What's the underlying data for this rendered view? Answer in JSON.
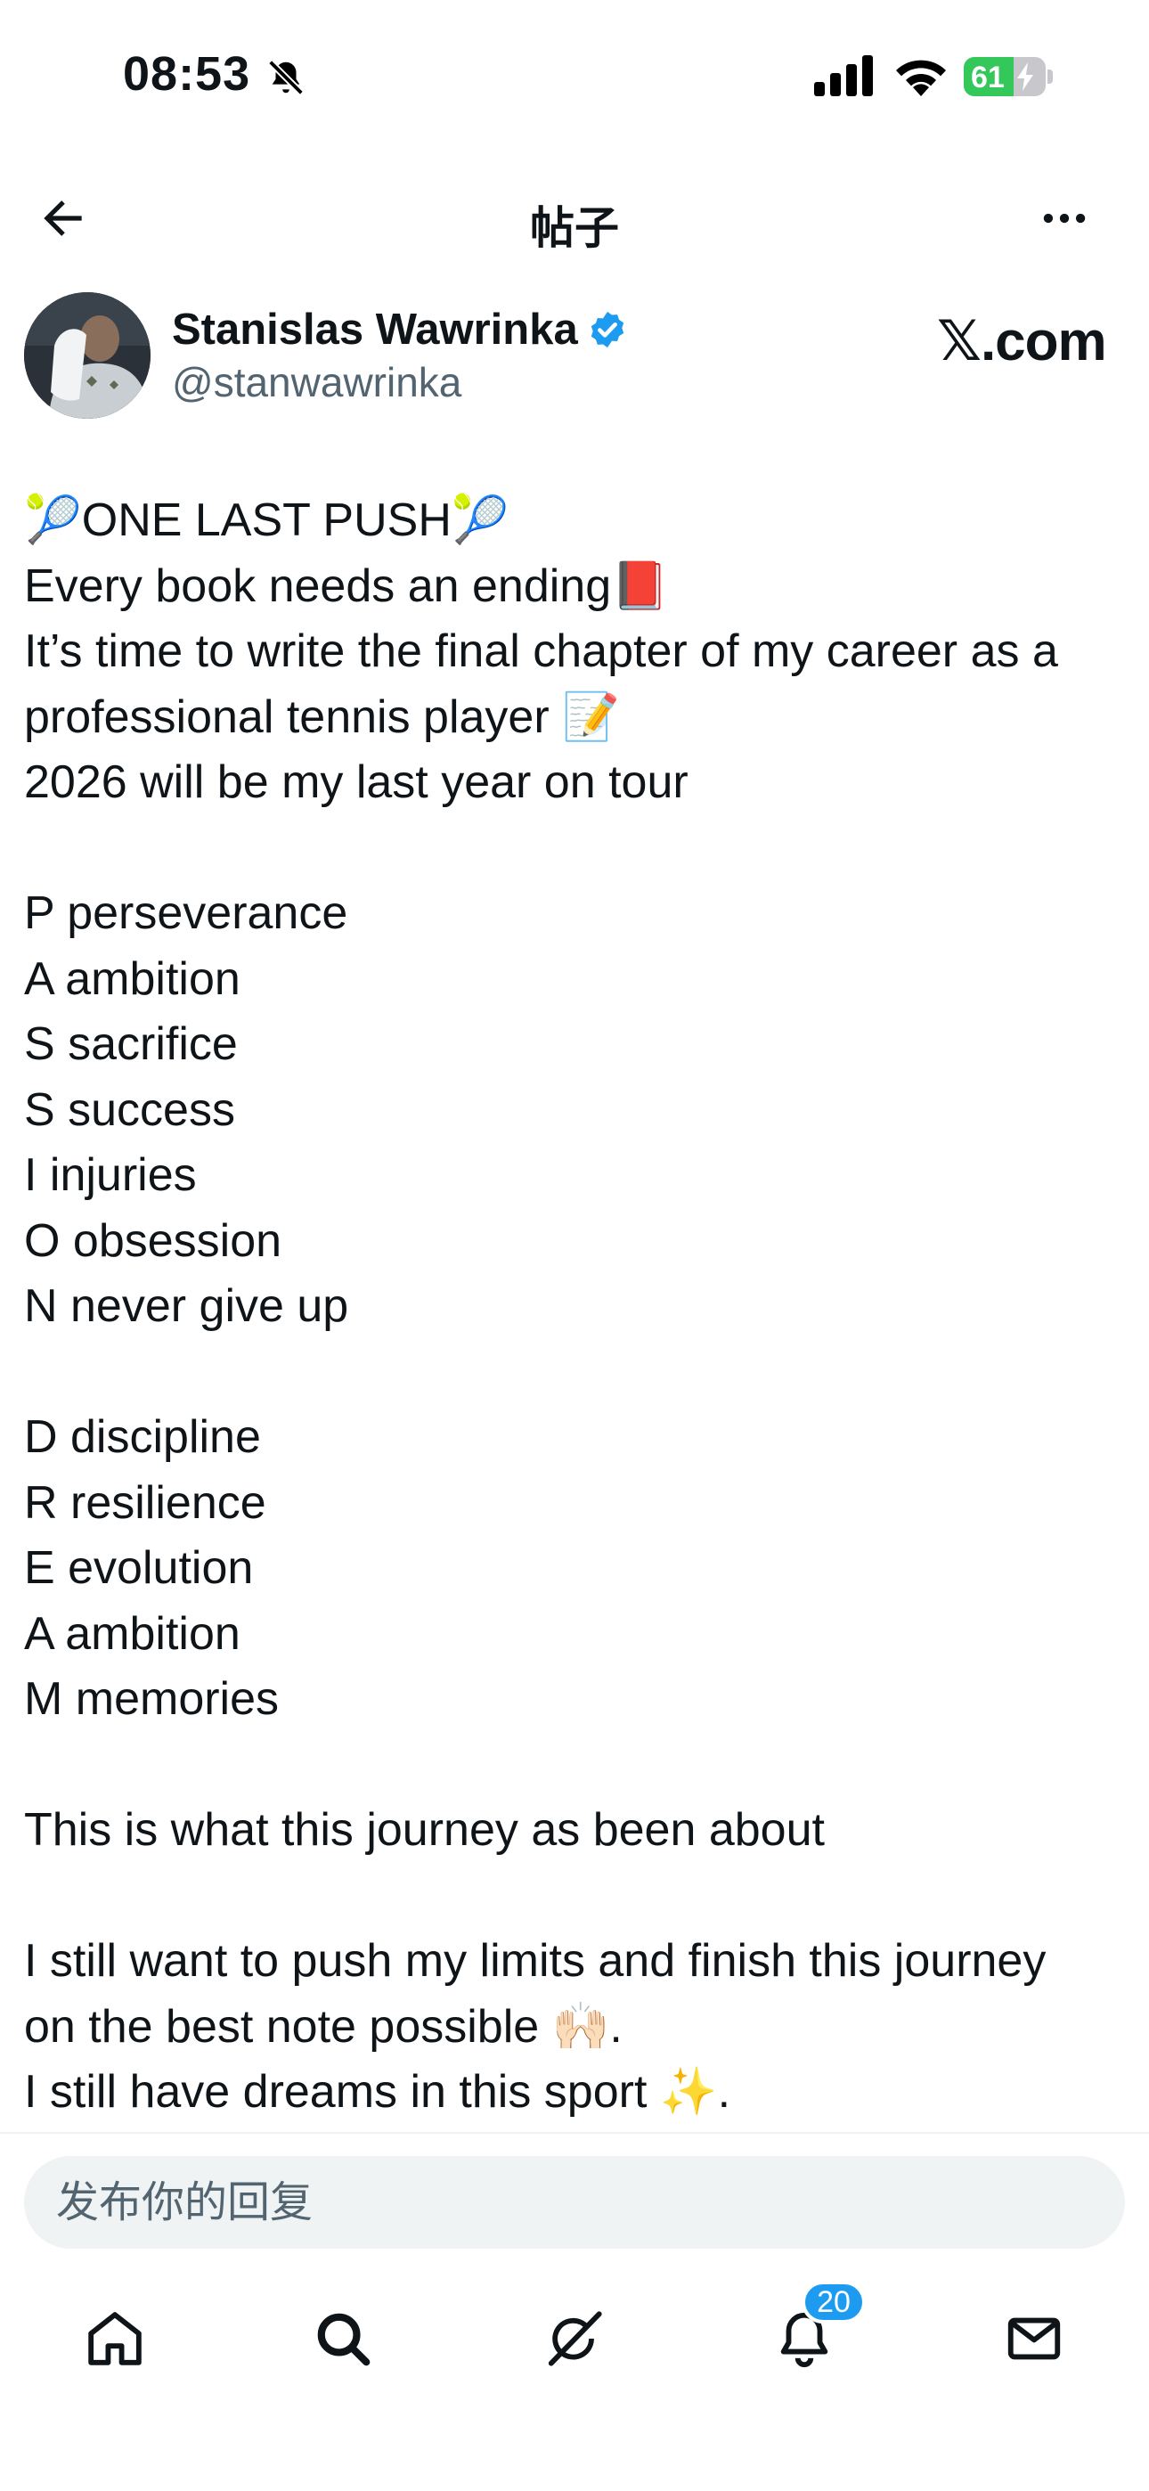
{
  "status_bar": {
    "time": "08:53",
    "battery_percent": "61",
    "battery_level": 0.61
  },
  "header": {
    "title": "帖子",
    "back_icon": "arrow-left-icon",
    "more_icon": "more-horizontal-icon"
  },
  "author": {
    "name": "Stanislas Wawrinka",
    "handle": "@stanwawrinka",
    "verified": true,
    "source": "𝕏.com"
  },
  "post": {
    "lines": [
      "🎾ONE LAST PUSH🎾",
      "Every book needs an ending📕",
      "It’s time to write the final chapter of my career as a",
      "professional tennis player 📝",
      "2026 will be my last year on tour",
      "",
      "P perseverance",
      "A ambition",
      "S sacrifice",
      "S success",
      "I injuries",
      "O obsession",
      "N never give up",
      "",
      "D discipline",
      "R resilience",
      "E evolution",
      "A ambition",
      "M memories",
      "",
      "This is what this journey as been about",
      "",
      "I still want to push my limits and finish this journey",
      "on the best note possible 🙌🏻.",
      "I still have dreams in this sport ✨."
    ]
  },
  "reply": {
    "placeholder": "发布你的回复"
  },
  "tab_bar": {
    "items": [
      {
        "name": "home",
        "icon": "home-icon"
      },
      {
        "name": "search",
        "icon": "search-icon"
      },
      {
        "name": "grok",
        "icon": "grok-icon"
      },
      {
        "name": "notifications",
        "icon": "bell-icon",
        "badge": "20"
      },
      {
        "name": "messages",
        "icon": "mail-icon"
      }
    ]
  },
  "colors": {
    "accent": "#1d9bf0",
    "text": "#0f1419",
    "secondary": "#536471",
    "battery_green": "#34c759"
  }
}
